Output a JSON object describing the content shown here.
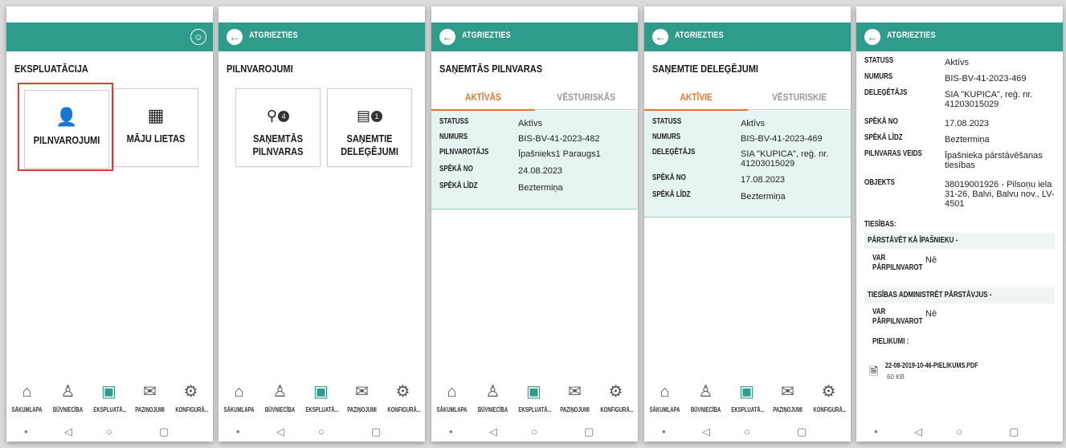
{
  "colors": {
    "accent": "#2e9b8b",
    "tab_active": "#e8742c",
    "highlight": "#e53935",
    "card_bg": "#e6f4f2"
  },
  "common": {
    "back_label": "ATGRIEZTIES",
    "nav": [
      {
        "label": "SĀKUMLAPA",
        "icon": "home-icon"
      },
      {
        "label": "BŪVNIECĪBA",
        "icon": "construction-worker-icon"
      },
      {
        "label": "EKSPLUATĀ...",
        "icon": "building-icon"
      },
      {
        "label": "PAZIŅOJUMI",
        "icon": "envelope-icon"
      },
      {
        "label": "KONFIGURĀ...",
        "icon": "gear-icon"
      }
    ]
  },
  "screen1": {
    "title": "EKSPLUATĀCIJA",
    "tiles": [
      {
        "label": "PILNVAROJUMI",
        "icon": "user-document-icon"
      },
      {
        "label": "MĀJU LIETAS",
        "icon": "building-icon"
      }
    ]
  },
  "screen2": {
    "title": "PILNVAROJUMI",
    "tiles": [
      {
        "label_line1": "SAŅEMTĀS",
        "label_line2": "PILNVARAS",
        "badge": "4",
        "icon": "user-arrow-icon"
      },
      {
        "label_line1": "SAŅEMTIE",
        "label_line2": "DELEĢĒJUMI",
        "badge": "1",
        "icon": "document-icon"
      }
    ]
  },
  "screen3": {
    "title": "SAŅEMTĀS PILNVARAS",
    "tab_active": "AKTĪVĀS",
    "tab_inactive": "VĒSTURISKĀS",
    "rows": [
      {
        "label": "STATUSS",
        "value": "Aktīvs"
      },
      {
        "label": "NUMURS",
        "value": "BIS-BV-41-2023-482"
      },
      {
        "label": "PILNVAROTĀJS",
        "value": "Īpašnieks1 Paraugs1"
      },
      {
        "label": "SPĒKĀ NO",
        "value": "24.08.2023"
      },
      {
        "label": "SPĒKĀ LĪDZ",
        "value": "Beztermiņa"
      }
    ]
  },
  "screen4": {
    "title": "SAŅEMTIE DELEĢĒJUMI",
    "tab_active": "AKTĪVIE",
    "tab_inactive": "VĒSTURISKIE",
    "rows": [
      {
        "label": "STATUSS",
        "value": "Aktīvs"
      },
      {
        "label": "NUMURS",
        "value": "BIS-BV-41-2023-469"
      },
      {
        "label": "DELEĢĒTĀJS",
        "value": "SIA \"KUPICA\", reģ. nr. 41203015029"
      },
      {
        "label": "SPĒKĀ NO",
        "value": "17.08.2023"
      },
      {
        "label": "SPĒKĀ LĪDZ",
        "value": "Beztermiņa"
      }
    ]
  },
  "screen5": {
    "rows": [
      {
        "label": "STATUSS",
        "value": "Aktīvs"
      },
      {
        "label": "NUMURS",
        "value": "BIS-BV-41-2023-469"
      },
      {
        "label": "DELEĢĒTĀJS",
        "value": "SIA \"KUPICA\", reģ. nr. 41203015029"
      },
      {
        "label": "SPĒKĀ NO",
        "value": "17.08.2023"
      },
      {
        "label": "SPĒKĀ LĪDZ",
        "value": "Beztermiņa"
      },
      {
        "label": "PILNVARAS VEIDS",
        "value": "Īpašnieka pārstāvēšanas tiesības"
      },
      {
        "label": "OBJEKTS",
        "value": "38019001926 - Pilsoņu iela 31-26, Balvi, Balvu nov., LV-4501"
      }
    ],
    "rights_title": "TIESĪBAS:",
    "rights": [
      {
        "title": "PĀRSTĀVĒT KĀ ĪPAŠNIEKU -",
        "sub_label": "VAR PĀRPILNVAROT",
        "sub_value": "Nē"
      },
      {
        "title": "TIESĪBAS ADMINISTRĒT PĀRSTĀVJUS -",
        "sub_label": "VAR PĀRPILNVAROT",
        "sub_value": "Nē"
      }
    ],
    "attachments_title": "PIELIKUMI :",
    "attachment_name": "22-08-2019-10-46-PIELIKUMS.PDF",
    "attachment_size": "60 KB"
  }
}
